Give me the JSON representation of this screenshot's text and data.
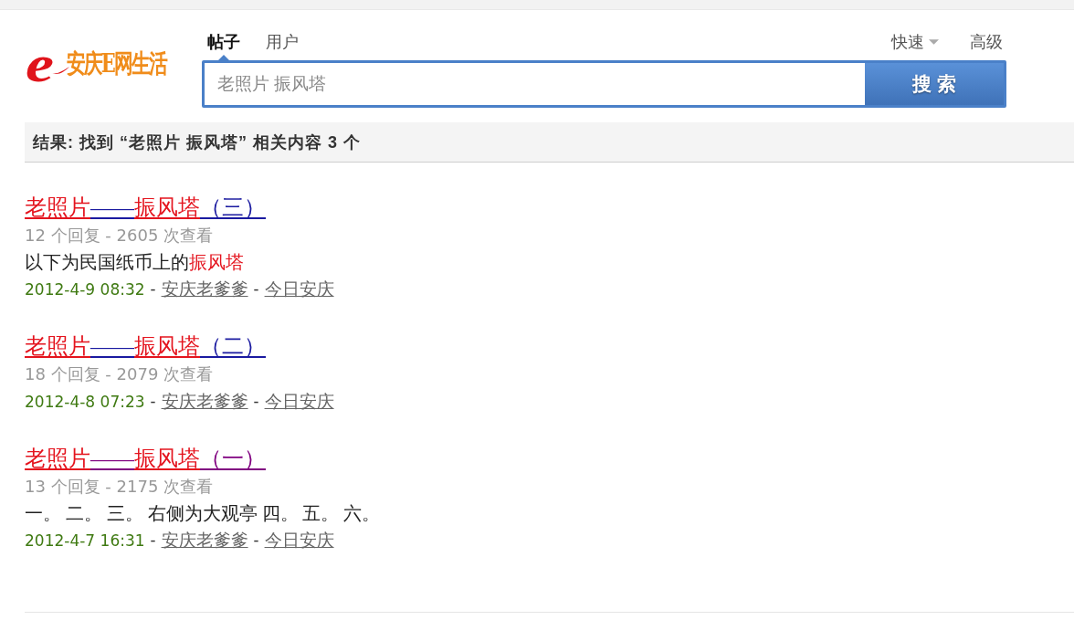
{
  "logo": {
    "mark": "e",
    "text": "安庆E网生活"
  },
  "tabs": [
    {
      "label": "帖子",
      "selected": true
    },
    {
      "label": "用户",
      "selected": false
    }
  ],
  "quick_menu": {
    "label": "快速"
  },
  "advanced_link": {
    "label": "高级"
  },
  "search": {
    "value": "老照片 振风塔",
    "button": "搜 索"
  },
  "summary": "结果: 找到 “老照片 振风塔” 相关内容 3 个",
  "results": [
    {
      "visited": false,
      "title": [
        {
          "text": "老照片",
          "highlight": true
        },
        {
          "text": "——",
          "highlight": false
        },
        {
          "text": "振风塔",
          "highlight": true
        },
        {
          "text": "（三）",
          "highlight": false
        }
      ],
      "stats": "12 个回复 - 2605 次查看",
      "snippet": [
        {
          "text": "以下为民国纸币上的",
          "highlight": false
        },
        {
          "text": "振风塔",
          "highlight": true
        }
      ],
      "meta": [
        {
          "kind": "date",
          "text": "2012-4-9 08:32"
        },
        {
          "kind": "sep",
          "text": "-"
        },
        {
          "kind": "author",
          "text": "安庆老爹爹"
        },
        {
          "kind": "sep",
          "text": "-"
        },
        {
          "kind": "forum",
          "text": "今日安庆"
        }
      ]
    },
    {
      "visited": false,
      "title": [
        {
          "text": "老照片",
          "highlight": true
        },
        {
          "text": "——",
          "highlight": false
        },
        {
          "text": "振风塔",
          "highlight": true
        },
        {
          "text": "（二）",
          "highlight": false
        }
      ],
      "stats": "18 个回复 - 2079 次查看",
      "meta": [
        {
          "kind": "date",
          "text": "2012-4-8 07:23"
        },
        {
          "kind": "sep",
          "text": "-"
        },
        {
          "kind": "author",
          "text": "安庆老爹爹"
        },
        {
          "kind": "sep",
          "text": "-"
        },
        {
          "kind": "forum",
          "text": "今日安庆"
        }
      ]
    },
    {
      "visited": true,
      "title": [
        {
          "text": "老照片",
          "highlight": true
        },
        {
          "text": "——",
          "highlight": false
        },
        {
          "text": "振风塔",
          "highlight": true
        },
        {
          "text": "（一）",
          "highlight": false
        }
      ],
      "stats": "13 个回复 - 2175 次查看",
      "snippet": [
        {
          "text": "一。 二。 三。 右侧为大观亭 四。 五。 六。",
          "highlight": false
        }
      ],
      "meta": [
        {
          "kind": "date",
          "text": "2012-4-7 16:31"
        },
        {
          "kind": "sep",
          "text": "-"
        },
        {
          "kind": "author",
          "text": "安庆老爹爹"
        },
        {
          "kind": "sep",
          "text": "-"
        },
        {
          "kind": "forum",
          "text": "今日安庆"
        }
      ]
    }
  ]
}
